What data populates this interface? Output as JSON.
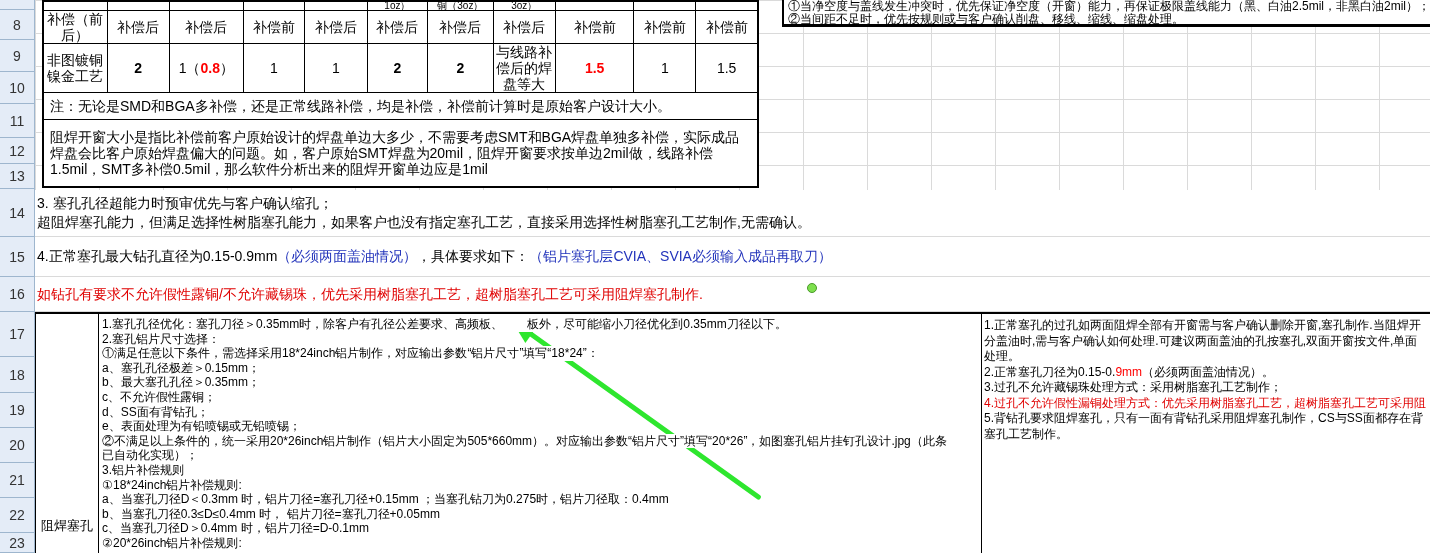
{
  "row_headers": [
    "8",
    "9",
    "10",
    "11",
    "12",
    "13",
    "14",
    "15",
    "16",
    "17",
    "18",
    "19",
    "20",
    "21",
    "22",
    "23"
  ],
  "top_table": {
    "columns": [
      {
        "header": "补偿（前后）"
      },
      {
        "header": "补偿后"
      },
      {
        "header": "补偿后"
      },
      {
        "header": "补偿前"
      },
      {
        "header": "补偿后"
      },
      {
        "top": "1oz）",
        "header": "补偿后"
      },
      {
        "top": "铜（3oz）",
        "header": "补偿后"
      },
      {
        "top": "3oz）",
        "header": "补偿后"
      },
      {
        "header": "补偿前"
      },
      {
        "header": "补偿前"
      },
      {
        "header": "补偿前"
      }
    ],
    "data_row": [
      {
        "parts": [
          {
            "text": "非图镀铜镍金工艺"
          }
        ]
      },
      {
        "parts": [
          {
            "text": "2",
            "bold": true
          }
        ]
      },
      {
        "parts": [
          {
            "text": "1（"
          },
          {
            "text": "0.8",
            "bold": true,
            "color": "#ff0000"
          },
          {
            "text": "）"
          }
        ]
      },
      {
        "parts": [
          {
            "text": "1"
          }
        ]
      },
      {
        "parts": [
          {
            "text": "1"
          }
        ]
      },
      {
        "parts": [
          {
            "text": "2",
            "bold": true
          }
        ]
      },
      {
        "parts": [
          {
            "text": "2",
            "bold": true
          }
        ]
      },
      {
        "parts": [
          {
            "text": "与线路补偿后的焊盘等大"
          }
        ]
      },
      {
        "parts": [
          {
            "text": "1.5",
            "bold": true,
            "color": "#ff0000"
          }
        ]
      },
      {
        "parts": [
          {
            "text": "1"
          }
        ]
      },
      {
        "parts": [
          {
            "text": "1.5"
          }
        ]
      }
    ],
    "note": "注：无论是SMD和BGA多补偿，还是正常线路补偿，均是补偿，补偿前计算时是原始客户设计大小。",
    "paragraph": "阻焊开窗大小是指比补偿前客户原始设计的焊盘单边大多少，不需要考虑SMT和BGA焊盘单独多补偿，实际成品焊盘会比客户原始焊盘偏大的问题。如，客户原始SMT焊盘为20mil，阻焊开窗要求按单边2mil做，线路补偿1.5mil，SMT多补偿0.5mil，那么软件分析出来的阻焊开窗单边应是1mil"
  },
  "top_right_note": [
    "①当净空度与盖线发生冲突时，优先保证净空度（开窗）能力，再保证极限盖线能力（黑、白油2.5mil，非黑白油2mil）；",
    "②当间距不足时，优先按规则或与客户确认削盘、移线、缩线、缩盘处理。"
  ],
  "rows": [
    {
      "lines": [
        {
          "parts": [
            {
              "text": "3. 塞孔孔径超能力时预审优先与客户确认缩孔；"
            }
          ]
        },
        {
          "parts": [
            {
              "text": "超阻焊塞孔能力，但满足选择性树脂塞孔能力，如果客户也没有指定塞孔工艺，直接采用选择性树脂塞孔工艺制作,无需确认。"
            }
          ]
        }
      ]
    },
    {
      "lines": [
        {
          "parts": [
            {
              "text": "4.正常塞孔最大钻孔直径为0.15-0.9mm"
            },
            {
              "text": "（必须两面盖油情况）",
              "color": "#2233bb"
            },
            {
              "text": "，具体要求如下："
            },
            {
              "text": "（铝片塞孔层CVIA、SVIA必须输入成品再取刀）",
              "color": "#2233bb"
            }
          ]
        }
      ]
    },
    {
      "lines": [
        {
          "parts": [
            {
              "text": "如钻孔有要求不允许假性露铜/不允许藏锡珠，优先采用树脂塞孔工艺，超树脂塞孔工艺可采用阻焊塞孔制作.",
              "color": "#e00000"
            }
          ]
        }
      ]
    }
  ],
  "bottom_table": {
    "label": "阻焊塞孔",
    "middle_lines": [
      {
        "parts": [
          {
            "text": "1.塞孔孔径优化：塞孔刀径＞0.35mm时，除客户有孔径公差要求、高频板、"
          },
          {
            "kind": "covered"
          },
          {
            "text": "板外，尽可能缩小刀径优化到0.35mm刀径以下。"
          }
        ]
      },
      {
        "parts": [
          {
            "text": "2.塞孔铝片尺寸选择："
          }
        ]
      },
      {
        "parts": [
          {
            "text": "①满足任意以下条件，需选择采用18*24inch铝片制作，对应输出参数“铝片尺寸”填写“18*24”："
          }
        ]
      },
      {
        "parts": [
          {
            "text": "a、塞孔孔径极差＞0.15mm；"
          }
        ]
      },
      {
        "parts": [
          {
            "text": "b、最大塞孔孔径＞0.35mm；"
          }
        ]
      },
      {
        "parts": [
          {
            "text": "c、不允许假性露铜；"
          }
        ]
      },
      {
        "parts": [
          {
            "text": "d、SS面有背钻孔；"
          }
        ]
      },
      {
        "parts": [
          {
            "text": "e、表面处理为有铅喷锡或无铅喷锡；"
          }
        ]
      },
      {
        "parts": [
          {
            "text": "②不满足以上条件的，统一采用20*26inch铝片制作（铝片大小固定为505*660mm）。对应输出参数“铝片尺寸”填写“20*26”，如图塞孔铝片挂钉孔设计.jpg（此条"
          }
        ]
      },
      {
        "parts": [
          {
            "text": "已自动化实现）；"
          }
        ]
      },
      {
        "parts": [
          {
            "text": "3.铝片补偿规则"
          }
        ]
      },
      {
        "parts": [
          {
            "text": "①18*24inch铝片补偿规则:"
          }
        ]
      },
      {
        "parts": [
          {
            "text": "a、当塞孔刀径D＜0.3mm 时，铝片刀径=塞孔刀径+0.15mm ；当塞孔钻刀为0.275时，铝片刀径取：0.4mm"
          }
        ]
      },
      {
        "parts": [
          {
            "text": "b、当塞孔刀径0.3≤D≤0.4mm 时， 铝片刀径=塞孔刀径+0.05mm"
          }
        ]
      },
      {
        "parts": [
          {
            "text": "c、当塞孔刀径D＞0.4mm 时，铝片刀径=D-0.1mm"
          }
        ]
      },
      {
        "parts": [
          {
            "text": "②20*26inch铝片补偿规则:"
          }
        ]
      }
    ],
    "right_lines": [
      {
        "parts": [
          {
            "text": "1.正常塞孔的过孔如两面阻焊全部有开窗需与客户确认删除开窗,塞孔制作.当阻焊开"
          }
        ]
      },
      {
        "parts": [
          {
            "text": "分盖油时,需与客户确认如何处理.可建议两面盖油的孔按塞孔,双面开窗按文件,单面"
          }
        ]
      },
      {
        "parts": [
          {
            "text": "处理。"
          }
        ]
      },
      {
        "parts": [
          {
            "text": "2.正常塞孔刀径为0.15-0."
          },
          {
            "text": "9mm",
            "color": "#ff0000"
          },
          {
            "text": "（必须两面盖油情况）。"
          }
        ]
      },
      {
        "parts": [
          {
            "text": "3.过孔不允许藏锡珠处理方式：采用树脂塞孔工艺制作；"
          }
        ]
      },
      {
        "parts": [
          {
            "text": "4.过孔不允许假性漏铜处理方式：优先采用树脂塞孔工艺，超树脂塞孔工艺可采用阻",
            "color": "#e00000"
          }
        ]
      },
      {
        "parts": [
          {
            "text": "5.背钻孔要求阻焊塞孔，只有一面有背钻孔采用阻焊塞孔制作，CS与SS面都存在背"
          }
        ]
      },
      {
        "parts": [
          {
            "text": "塞孔工艺制作。"
          }
        ]
      }
    ]
  }
}
